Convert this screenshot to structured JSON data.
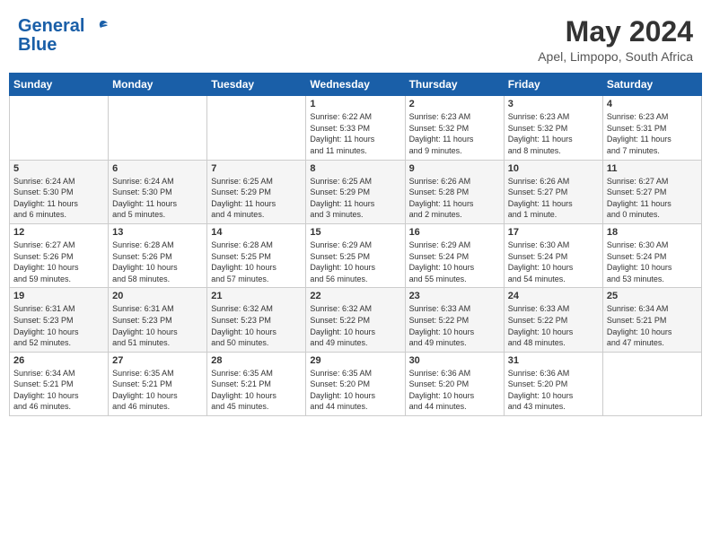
{
  "header": {
    "logo_line1": "General",
    "logo_line2": "Blue",
    "month": "May 2024",
    "location": "Apel, Limpopo, South Africa"
  },
  "weekdays": [
    "Sunday",
    "Monday",
    "Tuesday",
    "Wednesday",
    "Thursday",
    "Friday",
    "Saturday"
  ],
  "weeks": [
    [
      {
        "day": "",
        "info": ""
      },
      {
        "day": "",
        "info": ""
      },
      {
        "day": "",
        "info": ""
      },
      {
        "day": "1",
        "info": "Sunrise: 6:22 AM\nSunset: 5:33 PM\nDaylight: 11 hours\nand 11 minutes."
      },
      {
        "day": "2",
        "info": "Sunrise: 6:23 AM\nSunset: 5:32 PM\nDaylight: 11 hours\nand 9 minutes."
      },
      {
        "day": "3",
        "info": "Sunrise: 6:23 AM\nSunset: 5:32 PM\nDaylight: 11 hours\nand 8 minutes."
      },
      {
        "day": "4",
        "info": "Sunrise: 6:23 AM\nSunset: 5:31 PM\nDaylight: 11 hours\nand 7 minutes."
      }
    ],
    [
      {
        "day": "5",
        "info": "Sunrise: 6:24 AM\nSunset: 5:30 PM\nDaylight: 11 hours\nand 6 minutes."
      },
      {
        "day": "6",
        "info": "Sunrise: 6:24 AM\nSunset: 5:30 PM\nDaylight: 11 hours\nand 5 minutes."
      },
      {
        "day": "7",
        "info": "Sunrise: 6:25 AM\nSunset: 5:29 PM\nDaylight: 11 hours\nand 4 minutes."
      },
      {
        "day": "8",
        "info": "Sunrise: 6:25 AM\nSunset: 5:29 PM\nDaylight: 11 hours\nand 3 minutes."
      },
      {
        "day": "9",
        "info": "Sunrise: 6:26 AM\nSunset: 5:28 PM\nDaylight: 11 hours\nand 2 minutes."
      },
      {
        "day": "10",
        "info": "Sunrise: 6:26 AM\nSunset: 5:27 PM\nDaylight: 11 hours\nand 1 minute."
      },
      {
        "day": "11",
        "info": "Sunrise: 6:27 AM\nSunset: 5:27 PM\nDaylight: 11 hours\nand 0 minutes."
      }
    ],
    [
      {
        "day": "12",
        "info": "Sunrise: 6:27 AM\nSunset: 5:26 PM\nDaylight: 10 hours\nand 59 minutes."
      },
      {
        "day": "13",
        "info": "Sunrise: 6:28 AM\nSunset: 5:26 PM\nDaylight: 10 hours\nand 58 minutes."
      },
      {
        "day": "14",
        "info": "Sunrise: 6:28 AM\nSunset: 5:25 PM\nDaylight: 10 hours\nand 57 minutes."
      },
      {
        "day": "15",
        "info": "Sunrise: 6:29 AM\nSunset: 5:25 PM\nDaylight: 10 hours\nand 56 minutes."
      },
      {
        "day": "16",
        "info": "Sunrise: 6:29 AM\nSunset: 5:24 PM\nDaylight: 10 hours\nand 55 minutes."
      },
      {
        "day": "17",
        "info": "Sunrise: 6:30 AM\nSunset: 5:24 PM\nDaylight: 10 hours\nand 54 minutes."
      },
      {
        "day": "18",
        "info": "Sunrise: 6:30 AM\nSunset: 5:24 PM\nDaylight: 10 hours\nand 53 minutes."
      }
    ],
    [
      {
        "day": "19",
        "info": "Sunrise: 6:31 AM\nSunset: 5:23 PM\nDaylight: 10 hours\nand 52 minutes."
      },
      {
        "day": "20",
        "info": "Sunrise: 6:31 AM\nSunset: 5:23 PM\nDaylight: 10 hours\nand 51 minutes."
      },
      {
        "day": "21",
        "info": "Sunrise: 6:32 AM\nSunset: 5:23 PM\nDaylight: 10 hours\nand 50 minutes."
      },
      {
        "day": "22",
        "info": "Sunrise: 6:32 AM\nSunset: 5:22 PM\nDaylight: 10 hours\nand 49 minutes."
      },
      {
        "day": "23",
        "info": "Sunrise: 6:33 AM\nSunset: 5:22 PM\nDaylight: 10 hours\nand 49 minutes."
      },
      {
        "day": "24",
        "info": "Sunrise: 6:33 AM\nSunset: 5:22 PM\nDaylight: 10 hours\nand 48 minutes."
      },
      {
        "day": "25",
        "info": "Sunrise: 6:34 AM\nSunset: 5:21 PM\nDaylight: 10 hours\nand 47 minutes."
      }
    ],
    [
      {
        "day": "26",
        "info": "Sunrise: 6:34 AM\nSunset: 5:21 PM\nDaylight: 10 hours\nand 46 minutes."
      },
      {
        "day": "27",
        "info": "Sunrise: 6:35 AM\nSunset: 5:21 PM\nDaylight: 10 hours\nand 46 minutes."
      },
      {
        "day": "28",
        "info": "Sunrise: 6:35 AM\nSunset: 5:21 PM\nDaylight: 10 hours\nand 45 minutes."
      },
      {
        "day": "29",
        "info": "Sunrise: 6:35 AM\nSunset: 5:20 PM\nDaylight: 10 hours\nand 44 minutes."
      },
      {
        "day": "30",
        "info": "Sunrise: 6:36 AM\nSunset: 5:20 PM\nDaylight: 10 hours\nand 44 minutes."
      },
      {
        "day": "31",
        "info": "Sunrise: 6:36 AM\nSunset: 5:20 PM\nDaylight: 10 hours\nand 43 minutes."
      },
      {
        "day": "",
        "info": ""
      }
    ]
  ]
}
